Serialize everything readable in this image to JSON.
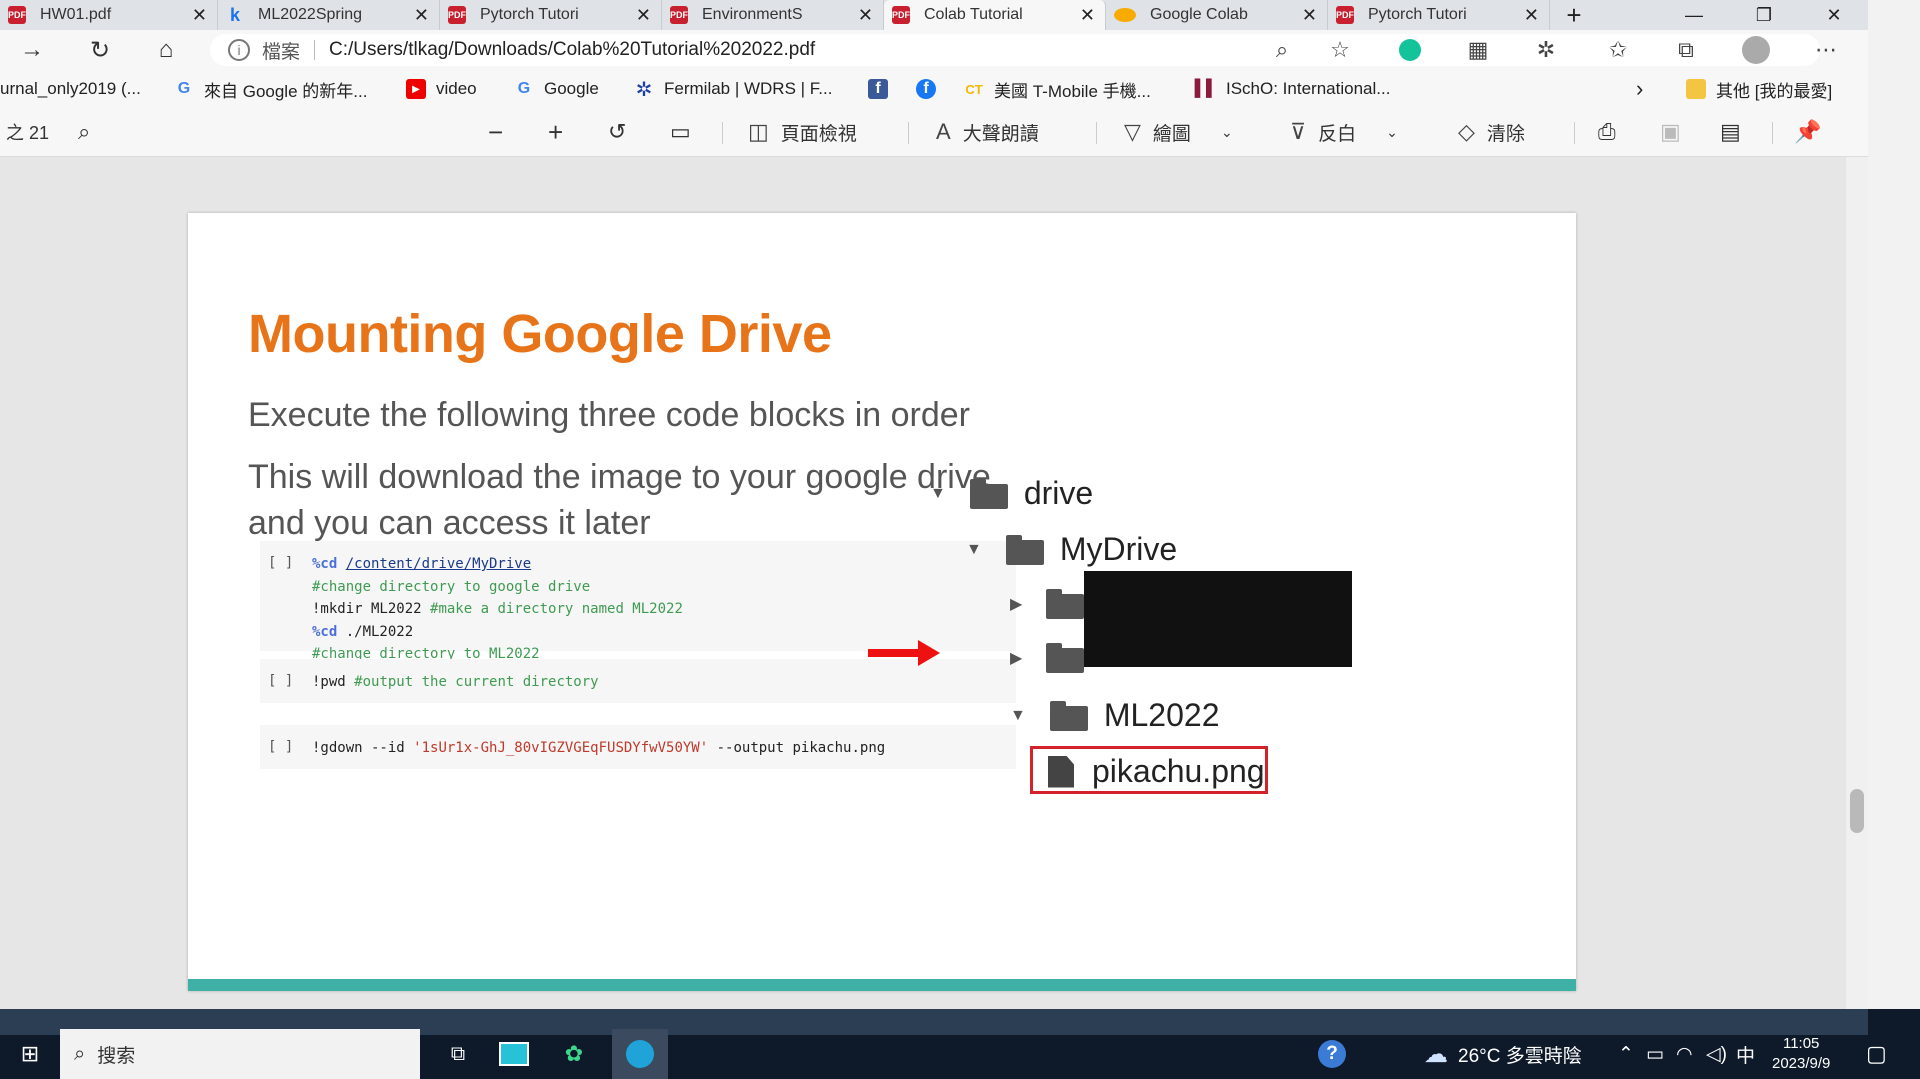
{
  "tabs": [
    {
      "label": "HW01.pdf",
      "icon": "pdf"
    },
    {
      "label": "ML2022Spring",
      "icon": "kaggle"
    },
    {
      "label": "Pytorch Tutori",
      "icon": "pdf"
    },
    {
      "label": "EnvironmentS",
      "icon": "pdf"
    },
    {
      "label": "Colab Tutorial",
      "icon": "pdf",
      "active": true
    },
    {
      "label": "Google Colab",
      "icon": "colab"
    },
    {
      "label": "Pytorch Tutori",
      "icon": "pdf"
    }
  ],
  "address": {
    "file_label": "檔案",
    "url": "C:/Users/tlkag/Downloads/Colab%20Tutorial%202022.pdf"
  },
  "bookmarks": [
    {
      "label": "urnal_only2019 (...",
      "icon": ""
    },
    {
      "label": "來自 Google 的新年...",
      "icon": "G"
    },
    {
      "label": "video",
      "icon": "youtube"
    },
    {
      "label": "Google",
      "icon": "G"
    },
    {
      "label": "Fermilab | WDRS | F...",
      "icon": "fermilab"
    },
    {
      "label": "",
      "icon": "facebook-square"
    },
    {
      "label": "",
      "icon": "facebook"
    },
    {
      "label": "美國 T-Mobile 手機...",
      "icon": "cr"
    },
    {
      "label": "ISchO: International...",
      "icon": "ischo"
    },
    {
      "label": "其他 [我的最愛]",
      "icon": "folder"
    }
  ],
  "pdf_toolbar": {
    "page_of": "之 21",
    "page_view": "頁面檢視",
    "read_aloud": "大聲朗讀",
    "draw": "繪圖",
    "highlight": "反白",
    "erase": "清除"
  },
  "slide": {
    "title": "Mounting Google Drive",
    "line1": "Execute the following three code blocks in order",
    "line2": "This will download the image to your google drive,",
    "line3": "and you can access it later",
    "code_cells": [
      {
        "bracket": "[ ]",
        "lines": [
          {
            "parts": [
              {
                "t": "%cd ",
                "c": "magic"
              },
              {
                "t": "/content/drive/MyDrive",
                "c": "path"
              }
            ]
          },
          {
            "parts": [
              {
                "t": "#change directory to google drive",
                "c": "cmt"
              }
            ]
          },
          {
            "parts": [
              {
                "t": "!mkdir ML2022 ",
                "c": ""
              },
              {
                "t": "#make a directory named ML2022",
                "c": "cmt"
              }
            ]
          },
          {
            "parts": [
              {
                "t": "%cd ",
                "c": "magic"
              },
              {
                "t": "./ML2022",
                "c": ""
              }
            ]
          },
          {
            "parts": [
              {
                "t": "#change directory to ML2022",
                "c": "cmt"
              }
            ]
          }
        ]
      },
      {
        "bracket": "[ ]",
        "lines": [
          {
            "parts": [
              {
                "t": "!pwd ",
                "c": ""
              },
              {
                "t": "#output the current directory",
                "c": "cmt"
              }
            ]
          }
        ]
      },
      {
        "bracket": "[ ]",
        "lines": [
          {
            "parts": [
              {
                "t": "!gdown --id ",
                "c": ""
              },
              {
                "t": "'1sUr1x-GhJ_80vIGZVGEqFUSDYfwV50YW'",
                "c": "str"
              },
              {
                "t": " --output pikachu.png",
                "c": ""
              }
            ]
          }
        ]
      }
    ],
    "tree": {
      "root": "drive",
      "my_drive": "MyDrive",
      "folder": "ML2022",
      "file": "pikachu.png"
    }
  },
  "taskbar": {
    "search_label": "搜索",
    "weather": "26°C 多雲時陰",
    "ime": "中",
    "time": "11:05",
    "date": "2023/9/9"
  },
  "colors": {
    "title_orange": "#e8741a",
    "accent_red": "#e11111",
    "teal_bar": "#3fb0a6"
  }
}
